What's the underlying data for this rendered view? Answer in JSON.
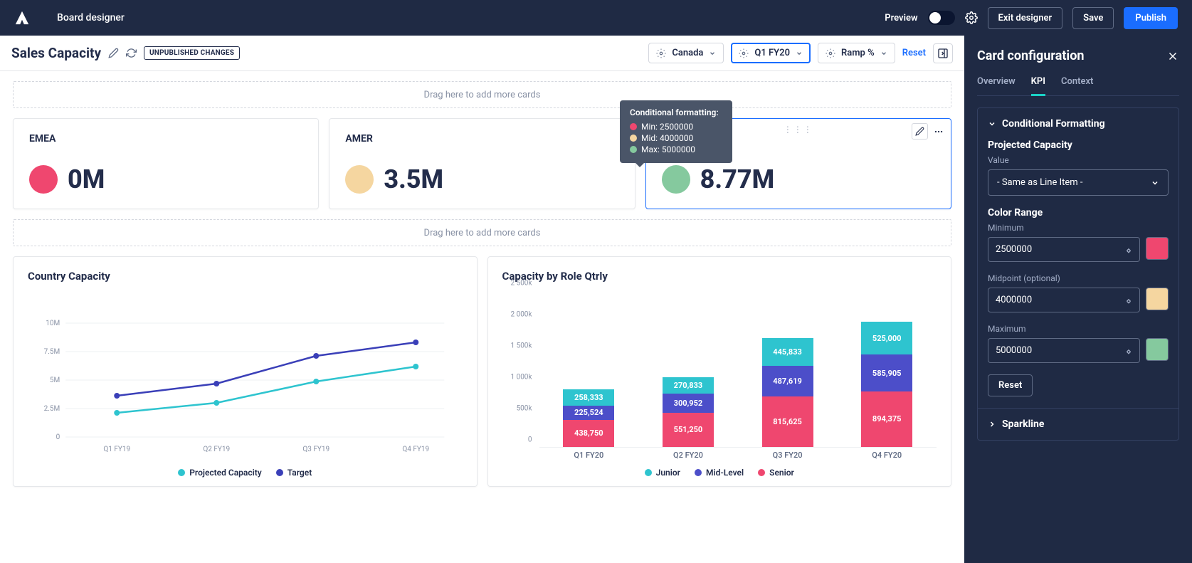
{
  "header": {
    "title": "Board designer",
    "preview": "Preview",
    "exit": "Exit designer",
    "save": "Save",
    "publish": "Publish"
  },
  "subheader": {
    "title": "Sales Capacity",
    "badge": "UNPUBLISHED CHANGES",
    "dd1": "Canada",
    "dd2": "Q1 FY20",
    "dd3": "Ramp %",
    "reset": "Reset"
  },
  "dropzone": "Drag here to add more cards",
  "kpi": {
    "emea": {
      "label": "EMEA",
      "value": "0M"
    },
    "amer": {
      "label": "AMER",
      "value": "3.5M"
    },
    "apac": {
      "value": "8.77M"
    }
  },
  "tooltip": {
    "title": "Conditional formatting:",
    "min": "Min: 2500000",
    "mid": "Mid: 4000000",
    "max": "Max: 5000000"
  },
  "chart1": {
    "title": "Country Capacity",
    "legend1": "Projected Capacity",
    "legend2": "Target"
  },
  "chart2": {
    "title": "Capacity by Role Qtrly",
    "legend_junior": "Junior",
    "legend_mid": "Mid-Level",
    "legend_senior": "Senior"
  },
  "config": {
    "title": "Card configuration",
    "tabs": {
      "overview": "Overview",
      "kpi": "KPI",
      "context": "Context"
    },
    "section1": "Conditional Formatting",
    "projected_label": "Projected Capacity",
    "value_label": "Value",
    "value_select": "- Same as Line Item -",
    "color_range": "Color Range",
    "min_label": "Minimum",
    "min_value": "2500000",
    "mid_label": "Midpoint (optional)",
    "mid_value": "4000000",
    "max_label": "Maximum",
    "max_value": "5000000",
    "reset": "Reset",
    "sparkline": "Sparkline"
  },
  "chart_data": [
    {
      "type": "line",
      "title": "Country Capacity",
      "x": [
        "Q1 FY19",
        "Q2 FY19",
        "Q3 FY19",
        "Q4 FY19"
      ],
      "series": [
        {
          "name": "Projected Capacity",
          "values": [
            2100000,
            3000000,
            4900000,
            6200000
          ],
          "color": "#2ec4cf"
        },
        {
          "name": "Target",
          "values": [
            3600000,
            4700000,
            7100000,
            8300000
          ],
          "color": "#3a3fb8"
        }
      ],
      "ylim": [
        0,
        10000000
      ],
      "y_ticks": [
        "0",
        "2.5M",
        "5M",
        "7.5M",
        "10M"
      ]
    },
    {
      "type": "bar",
      "stacked": true,
      "title": "Capacity by Role Qtrly",
      "categories": [
        "Q1 FY20",
        "Q2 FY20",
        "Q3 FY20",
        "Q4 FY20"
      ],
      "series": [
        {
          "name": "Senior",
          "values": [
            438750,
            551250,
            815625,
            894375
          ],
          "color": "#ef476f"
        },
        {
          "name": "Mid-Level",
          "values": [
            225524,
            300952,
            487619,
            585905
          ],
          "color": "#4c4ec9"
        },
        {
          "name": "Junior",
          "values": [
            258333,
            270833,
            445833,
            525000
          ],
          "color": "#2ec4cf"
        }
      ],
      "ylim": [
        0,
        2500000
      ],
      "y_ticks": [
        "0",
        "500k",
        "1 000k",
        "1 500k",
        "2 000k",
        "2 500k"
      ]
    }
  ]
}
